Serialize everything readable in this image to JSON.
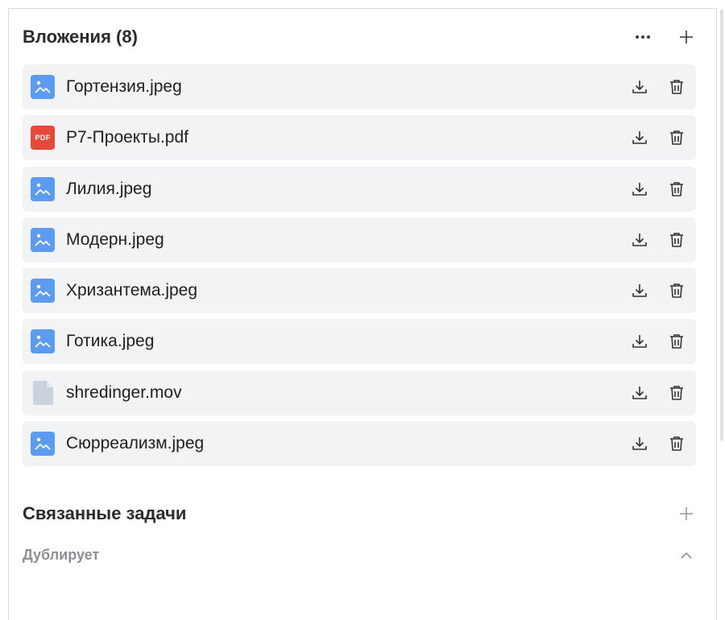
{
  "attachments": {
    "title": "Вложения (8)",
    "more_icon": "more-horizontal-icon",
    "add_icon": "plus-icon",
    "items": [
      {
        "name": "Гортензия.jpeg",
        "type": "image"
      },
      {
        "name": "P7-Проекты.pdf",
        "type": "pdf",
        "badge": "PDF"
      },
      {
        "name": "Лилия.jpeg",
        "type": "image"
      },
      {
        "name": "Модерн.jpeg",
        "type": "image"
      },
      {
        "name": "Хризантема.jpeg",
        "type": "image"
      },
      {
        "name": "Готика.jpeg",
        "type": "image"
      },
      {
        "name": "shredinger.mov",
        "type": "generic"
      },
      {
        "name": "Сюрреализм.jpeg",
        "type": "image"
      }
    ],
    "row_icons": [
      "download-icon",
      "trash-icon"
    ]
  },
  "related_tasks": {
    "title": "Связанные задачи",
    "add_icon": "plus-icon",
    "group": {
      "title": "Дублирует",
      "toggle_icon": "chevron-up-icon"
    }
  },
  "colors": {
    "image_icon": "#5b9cf0",
    "pdf_badge": "#e5493a",
    "generic_file": "#c9d3df",
    "row_background": "#f2f3f5",
    "muted_text": "#8d8f94"
  }
}
